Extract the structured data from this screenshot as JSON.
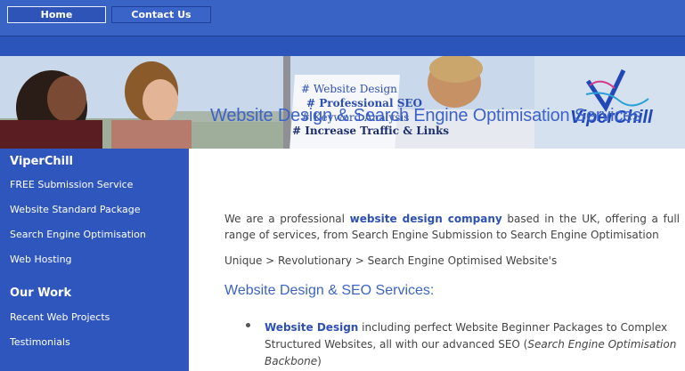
{
  "nav": {
    "home": "Home",
    "contact": "Contact Us"
  },
  "banner": {
    "title": "Website Design & Search Engine Optimisation Services",
    "flipchart": [
      "# Website Design",
      "# Professional SEO",
      "# Keyword Analysis",
      "# Increase Traffic & Links"
    ],
    "logo": "ViperChill"
  },
  "sidebar": {
    "heading1": "ViperChill",
    "links1": [
      "FREE Submission Service",
      "Website Standard Package",
      "Search Engine Optimisation",
      "Web Hosting"
    ],
    "heading2": "Our Work",
    "links2": [
      "Recent Web Projects",
      "Testimonials"
    ]
  },
  "main": {
    "intro_prefix": "We are a professional ",
    "intro_bold": "website design company",
    "intro_suffix": " based in the UK, offering a full range of services, from Search Engine Submission to Search Engine Optimisation",
    "breadcrumb": "Unique > Revolutionary > Search Engine Optimised Website's",
    "heading": "Website Design & SEO Services:",
    "bullet_bold": "Website Design",
    "bullet_text": " including perfect Website Beginner Packages to Complex Structured Websites, all with our advanced SEO (",
    "bullet_italic": "Search Engine Optimisation Backbone",
    "bullet_end": ")"
  },
  "colors": {
    "nav_blue": "#3a63c6",
    "sidebar_blue": "#2e56bd",
    "accent_link": "#2d50b3"
  }
}
